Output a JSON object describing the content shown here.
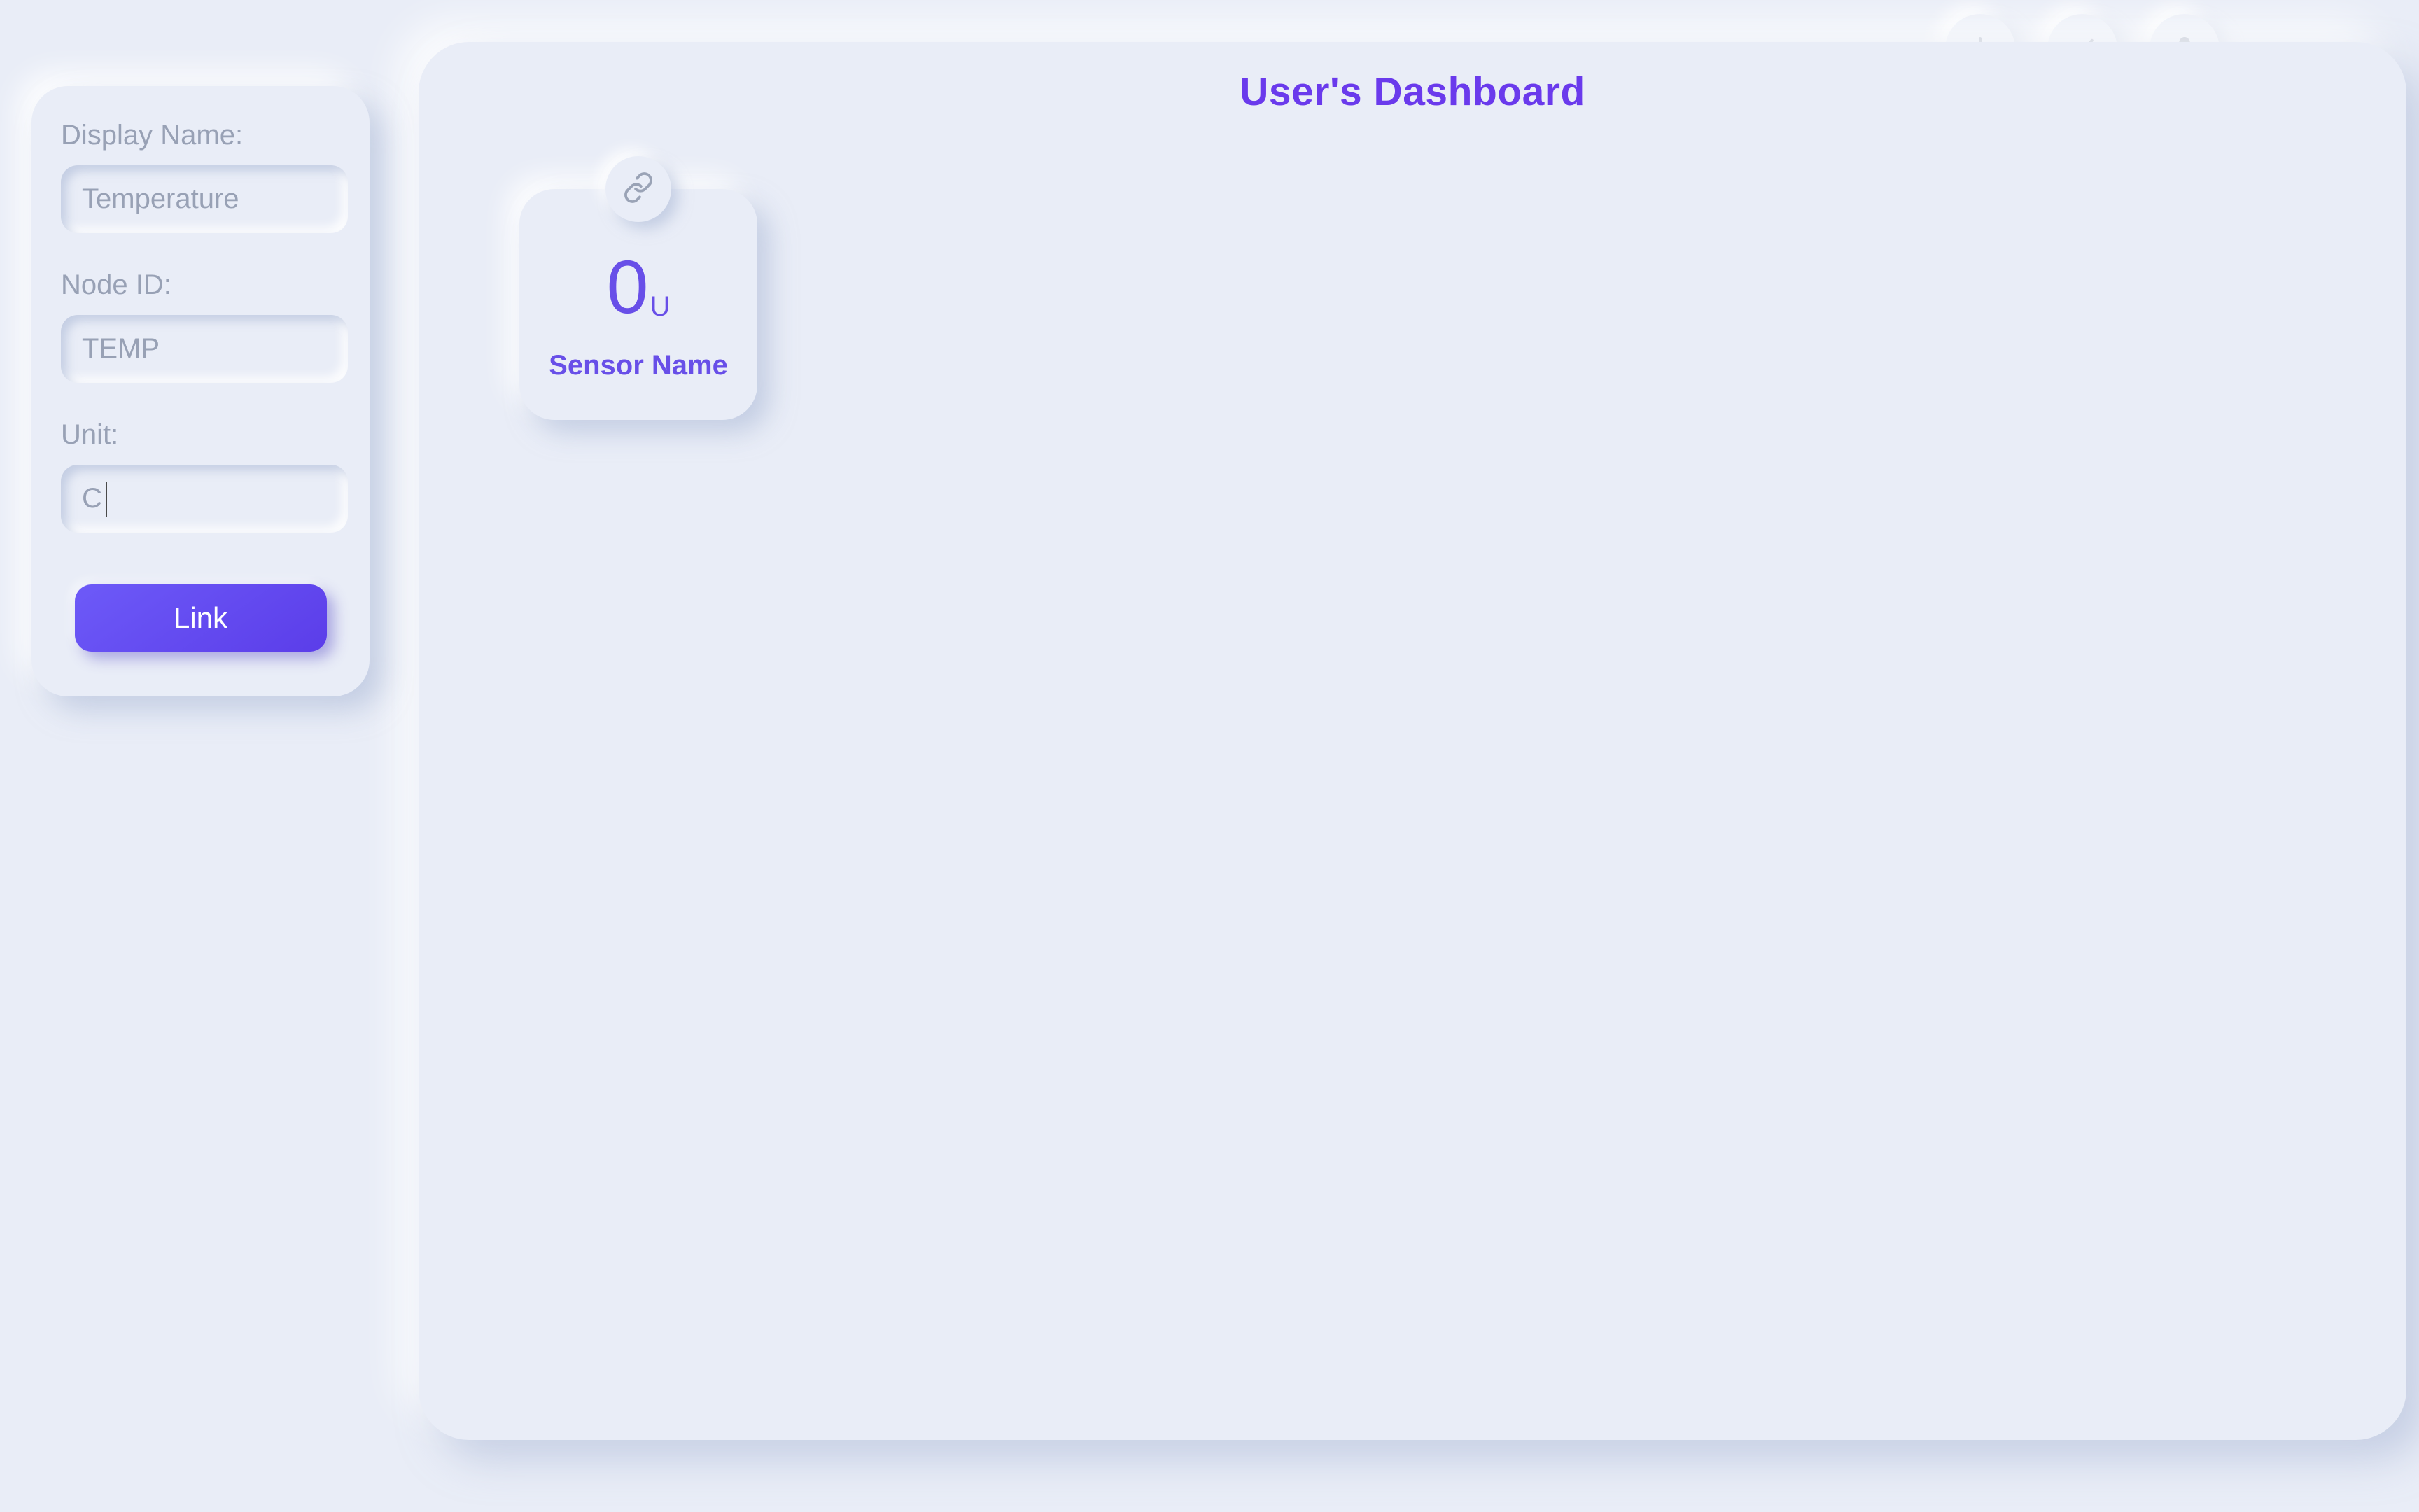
{
  "colors": {
    "bg": "#e9edf7",
    "accent": "#6a3aec",
    "textMuted": "#98a1b5",
    "iconMuted": "#9aa3b6"
  },
  "header": {
    "title": "User's Dashboard",
    "actions": {
      "add_icon": "plus-icon",
      "confirm_icon": "check-icon",
      "profile_icon": "user-icon"
    }
  },
  "sidebar_form": {
    "display_name": {
      "label": "Display Name:",
      "placeholder": "Temperature",
      "value": ""
    },
    "node_id": {
      "label": "Node ID:",
      "placeholder": "TEMP",
      "value": ""
    },
    "unit": {
      "label": "Unit:",
      "placeholder": "",
      "value": "C"
    },
    "link_button_label": "Link"
  },
  "sensor_card": {
    "value": "0",
    "unit": "U",
    "name": "Sensor Name",
    "badge_icon": "link-icon"
  }
}
